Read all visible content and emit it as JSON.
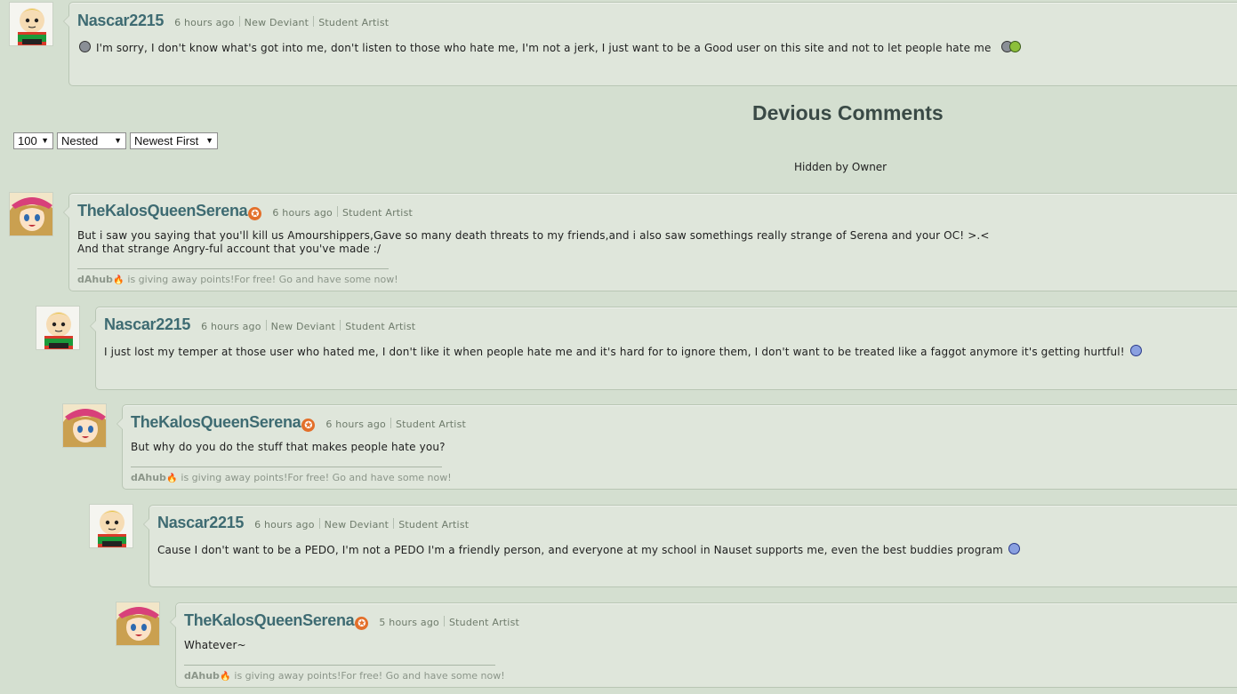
{
  "section_title": "Devious Comments",
  "hidden_note": "Hidden by Owner",
  "controls": {
    "per_page": "100",
    "thread_mode": "Nested",
    "sort_order": "Newest First"
  },
  "comments": [
    {
      "username": "Nascar2215",
      "time": "6 hours ago",
      "tags": [
        "New Deviant",
        "Student Artist"
      ],
      "text_lines": [
        "I'm sorry, I don't know what's got into me, don't listen to those who hate me, I'm not a jerk, I just want to be a Good user on this site and not to let people hate me"
      ],
      "emoticons": [
        "upset-emoticon",
        "sick-emoticon"
      ]
    },
    {
      "username": "TheKalosQueenSerena",
      "time": "6 hours ago",
      "tags": [
        "Student Artist"
      ],
      "text_lines": [
        "But i saw you saying that you'll kill us Amourshippers,Gave so many death threats to my friends,and i also saw somethings really strange of Serena and your OC! >.<",
        "And that strange Angry-ful account that you've made :/"
      ],
      "signature": {
        "name": "dAhub",
        "text": "is giving away points!For free! Go and have some now!"
      }
    },
    {
      "username": "Nascar2215",
      "time": "6 hours ago",
      "tags": [
        "New Deviant",
        "Student Artist"
      ],
      "text_lines": [
        "I just lost my temper at those user who hated me, I don't like it when people hate me and it's hard for to ignore them, I don't want to be treated like a faggot anymore it's getting hurtful!"
      ],
      "emoticons": [
        "sad-emoticon"
      ]
    },
    {
      "username": "TheKalosQueenSerena",
      "time": "6 hours ago",
      "tags": [
        "Student Artist"
      ],
      "text_lines": [
        "But why do you do the stuff that makes people hate you?"
      ],
      "signature": {
        "name": "dAhub",
        "text": "is giving away points!For free! Go and have some now!"
      }
    },
    {
      "username": "Nascar2215",
      "time": "6 hours ago",
      "tags": [
        "New Deviant",
        "Student Artist"
      ],
      "text_lines": [
        "Cause I don't want to be a PEDO, I'm not a PEDO I'm a friendly person, and everyone at my school in Nauset supports me, even the best buddies program"
      ],
      "emoticons": [
        "sad-emoticon"
      ]
    },
    {
      "username": "TheKalosQueenSerena",
      "time": "5 hours ago",
      "tags": [
        "Student Artist"
      ],
      "text_lines": [
        "Whatever~"
      ],
      "signature": {
        "name": "dAhub",
        "text": "is giving away points!For free! Go and have some now!"
      }
    }
  ],
  "colors": {
    "background": "#d4dfd0",
    "username": "#3e6b72",
    "badge": "#e36f2a"
  }
}
